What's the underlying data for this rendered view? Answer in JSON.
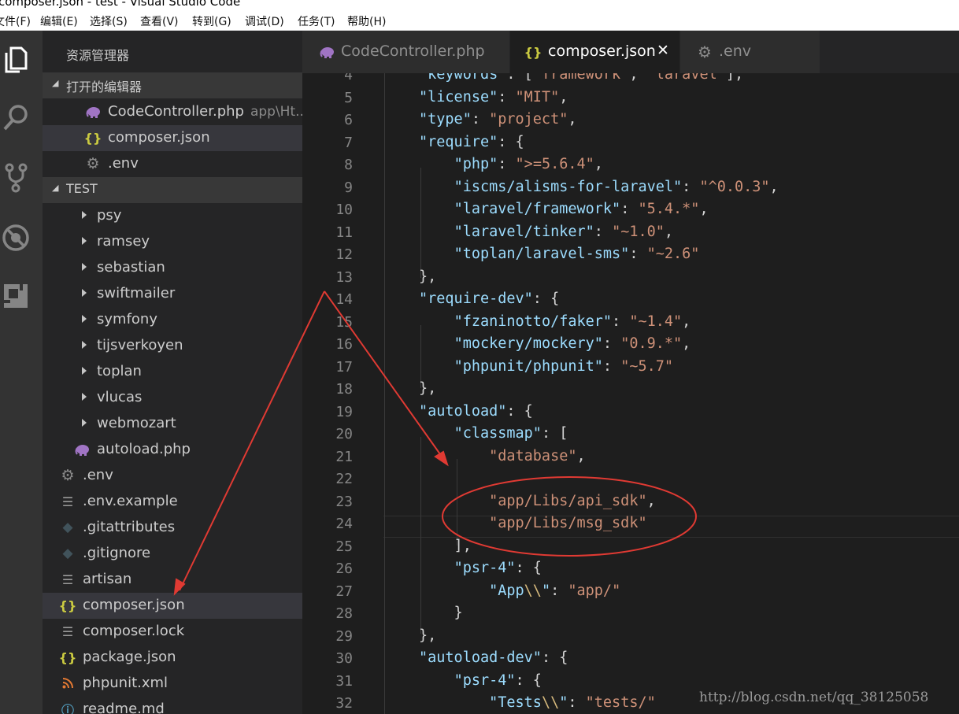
{
  "window": {
    "title": "composer.json - test - Visual Studio Code"
  },
  "menu": [
    "文件(F)",
    "编辑(E)",
    "选择(S)",
    "查看(V)",
    "转到(G)",
    "调试(D)",
    "任务(T)",
    "帮助(H)"
  ],
  "sidebar": {
    "title": "资源管理器",
    "open_editors": {
      "header": "打开的编辑器",
      "items": [
        {
          "label": "CodeController.php",
          "desc": "app\\Ht...",
          "icon": "php-elephant-icon"
        },
        {
          "label": "composer.json",
          "icon": "json-braces-icon"
        },
        {
          "label": ".env",
          "icon": "gear-icon"
        }
      ]
    },
    "project": {
      "header": "TEST",
      "folders": [
        "psy",
        "ramsey",
        "sebastian",
        "swiftmailer",
        "symfony",
        "tijsverkoyen",
        "toplan",
        "vlucas",
        "webmozart"
      ],
      "vendor_file": "autoload.php",
      "files": [
        ".env",
        ".env.example",
        ".gitattributes",
        ".gitignore",
        "artisan",
        "composer.json",
        "composer.lock",
        "package.json",
        "phpunit.xml",
        "readme.md"
      ]
    }
  },
  "tabs": [
    {
      "label": "CodeController.php",
      "icon": "php-elephant-icon"
    },
    {
      "label": "composer.json",
      "icon": "json-braces-icon",
      "close": "✕"
    },
    {
      "label": ".env",
      "icon": "gear-icon"
    }
  ],
  "editor": {
    "line_numbers": [
      "4",
      "5",
      "6",
      "7",
      "8",
      "9",
      "10",
      "11",
      "12",
      "13",
      "14",
      "15",
      "16",
      "17",
      "18",
      "19",
      "20",
      "21",
      "22",
      "23",
      "24",
      "25",
      "26",
      "27",
      "28",
      "29",
      "30",
      "31",
      "32"
    ],
    "lines": [
      [
        [
          "k",
          "\"keywords\""
        ],
        [
          "p",
          ": ["
        ],
        [
          "s",
          "\"framework\""
        ],
        [
          "p",
          ", "
        ],
        [
          "s",
          "\"laravel\""
        ],
        [
          "p",
          "],"
        ]
      ],
      [
        [
          "k",
          "\"license\""
        ],
        [
          "p",
          ": "
        ],
        [
          "s",
          "\"MIT\""
        ],
        [
          "p",
          ","
        ]
      ],
      [
        [
          "k",
          "\"type\""
        ],
        [
          "p",
          ": "
        ],
        [
          "s",
          "\"project\""
        ],
        [
          "p",
          ","
        ]
      ],
      [
        [
          "k",
          "\"require\""
        ],
        [
          "p",
          ": {"
        ]
      ],
      [
        [
          "p",
          "    "
        ],
        [
          "k",
          "\"php\""
        ],
        [
          "p",
          ": "
        ],
        [
          "s",
          "\">=5.6.4\""
        ],
        [
          "p",
          ","
        ]
      ],
      [
        [
          "p",
          "    "
        ],
        [
          "k",
          "\"iscms/alisms-for-laravel\""
        ],
        [
          "p",
          ": "
        ],
        [
          "s",
          "\"^0.0.3\""
        ],
        [
          "p",
          ","
        ]
      ],
      [
        [
          "p",
          "    "
        ],
        [
          "k",
          "\"laravel/framework\""
        ],
        [
          "p",
          ": "
        ],
        [
          "s",
          "\"5.4.*\""
        ],
        [
          "p",
          ","
        ]
      ],
      [
        [
          "p",
          "    "
        ],
        [
          "k",
          "\"laravel/tinker\""
        ],
        [
          "p",
          ": "
        ],
        [
          "s",
          "\"~1.0\""
        ],
        [
          "p",
          ","
        ]
      ],
      [
        [
          "p",
          "    "
        ],
        [
          "k",
          "\"toplan/laravel-sms\""
        ],
        [
          "p",
          ": "
        ],
        [
          "s",
          "\"~2.6\""
        ]
      ],
      [
        [
          "p",
          "},"
        ]
      ],
      [
        [
          "k",
          "\"require-dev\""
        ],
        [
          "p",
          ": {"
        ]
      ],
      [
        [
          "p",
          "    "
        ],
        [
          "k",
          "\"fzaninotto/faker\""
        ],
        [
          "p",
          ": "
        ],
        [
          "s",
          "\"~1.4\""
        ],
        [
          "p",
          ","
        ]
      ],
      [
        [
          "p",
          "    "
        ],
        [
          "k",
          "\"mockery/mockery\""
        ],
        [
          "p",
          ": "
        ],
        [
          "s",
          "\"0.9.*\""
        ],
        [
          "p",
          ","
        ]
      ],
      [
        [
          "p",
          "    "
        ],
        [
          "k",
          "\"phpunit/phpunit\""
        ],
        [
          "p",
          ": "
        ],
        [
          "s",
          "\"~5.7\""
        ]
      ],
      [
        [
          "p",
          "},"
        ]
      ],
      [
        [
          "k",
          "\"autoload\""
        ],
        [
          "p",
          ": {"
        ]
      ],
      [
        [
          "p",
          "    "
        ],
        [
          "k",
          "\"classmap\""
        ],
        [
          "p",
          ": ["
        ]
      ],
      [
        [
          "p",
          "        "
        ],
        [
          "s",
          "\"database\""
        ],
        [
          "p",
          ","
        ]
      ],
      [
        [
          "p",
          ""
        ]
      ],
      [
        [
          "p",
          "        "
        ],
        [
          "s",
          "\"app/Libs/api_sdk\""
        ],
        [
          "p",
          ","
        ]
      ],
      [
        [
          "p",
          "        "
        ],
        [
          "s",
          "\"app/Libs/msg_sdk\""
        ]
      ],
      [
        [
          "p",
          "    ],"
        ]
      ],
      [
        [
          "p",
          "    "
        ],
        [
          "k",
          "\"psr-4\""
        ],
        [
          "p",
          ": {"
        ]
      ],
      [
        [
          "p",
          "        "
        ],
        [
          "k",
          "\"App"
        ],
        [
          "e",
          "\\\\"
        ],
        [
          "k",
          "\""
        ],
        [
          "p",
          ": "
        ],
        [
          "s",
          "\"app/\""
        ]
      ],
      [
        [
          "p",
          "    }"
        ]
      ],
      [
        [
          "p",
          "},"
        ]
      ],
      [
        [
          "k",
          "\"autoload-dev\""
        ],
        [
          "p",
          ": {"
        ]
      ],
      [
        [
          "p",
          "    "
        ],
        [
          "k",
          "\"psr-4\""
        ],
        [
          "p",
          ": {"
        ]
      ],
      [
        [
          "p",
          "        "
        ],
        [
          "k",
          "\"Tests"
        ],
        [
          "e",
          "\\\\"
        ],
        [
          "k",
          "\""
        ],
        [
          "p",
          ": "
        ],
        [
          "s",
          "\"tests/\""
        ]
      ]
    ]
  },
  "watermark": "http://blog.csdn.net/qq_38125058",
  "colors": {
    "accent_annotation": "#e03a33",
    "json_icon": "#cbcb41",
    "php_icon": "#a074c4",
    "xml_icon": "#e37933",
    "info_icon": "#519aba"
  }
}
